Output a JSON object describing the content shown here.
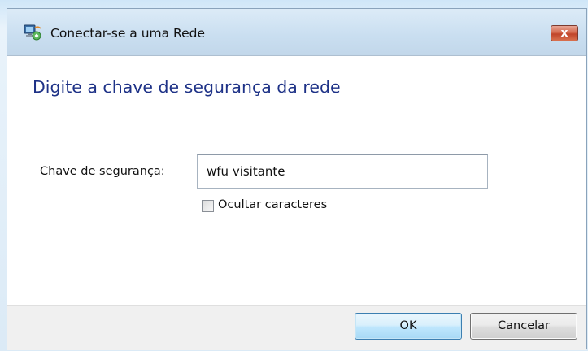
{
  "window": {
    "title": "Conectar-se a uma Rede",
    "close_label": "x",
    "icon": "network-icon"
  },
  "main": {
    "heading": "Digite a chave de segurança da rede",
    "security_key": {
      "label": "Chave de segurança:",
      "value": "wfu visitante"
    },
    "hide_characters": {
      "label": "Ocultar caracteres",
      "checked": false
    }
  },
  "footer": {
    "ok_label": "OK",
    "cancel_label": "Cancelar"
  },
  "colors": {
    "heading": "#1e3287",
    "titlebar": "#c9def0",
    "close_button": "#c0452a",
    "default_button_border": "#3c7fb1"
  }
}
